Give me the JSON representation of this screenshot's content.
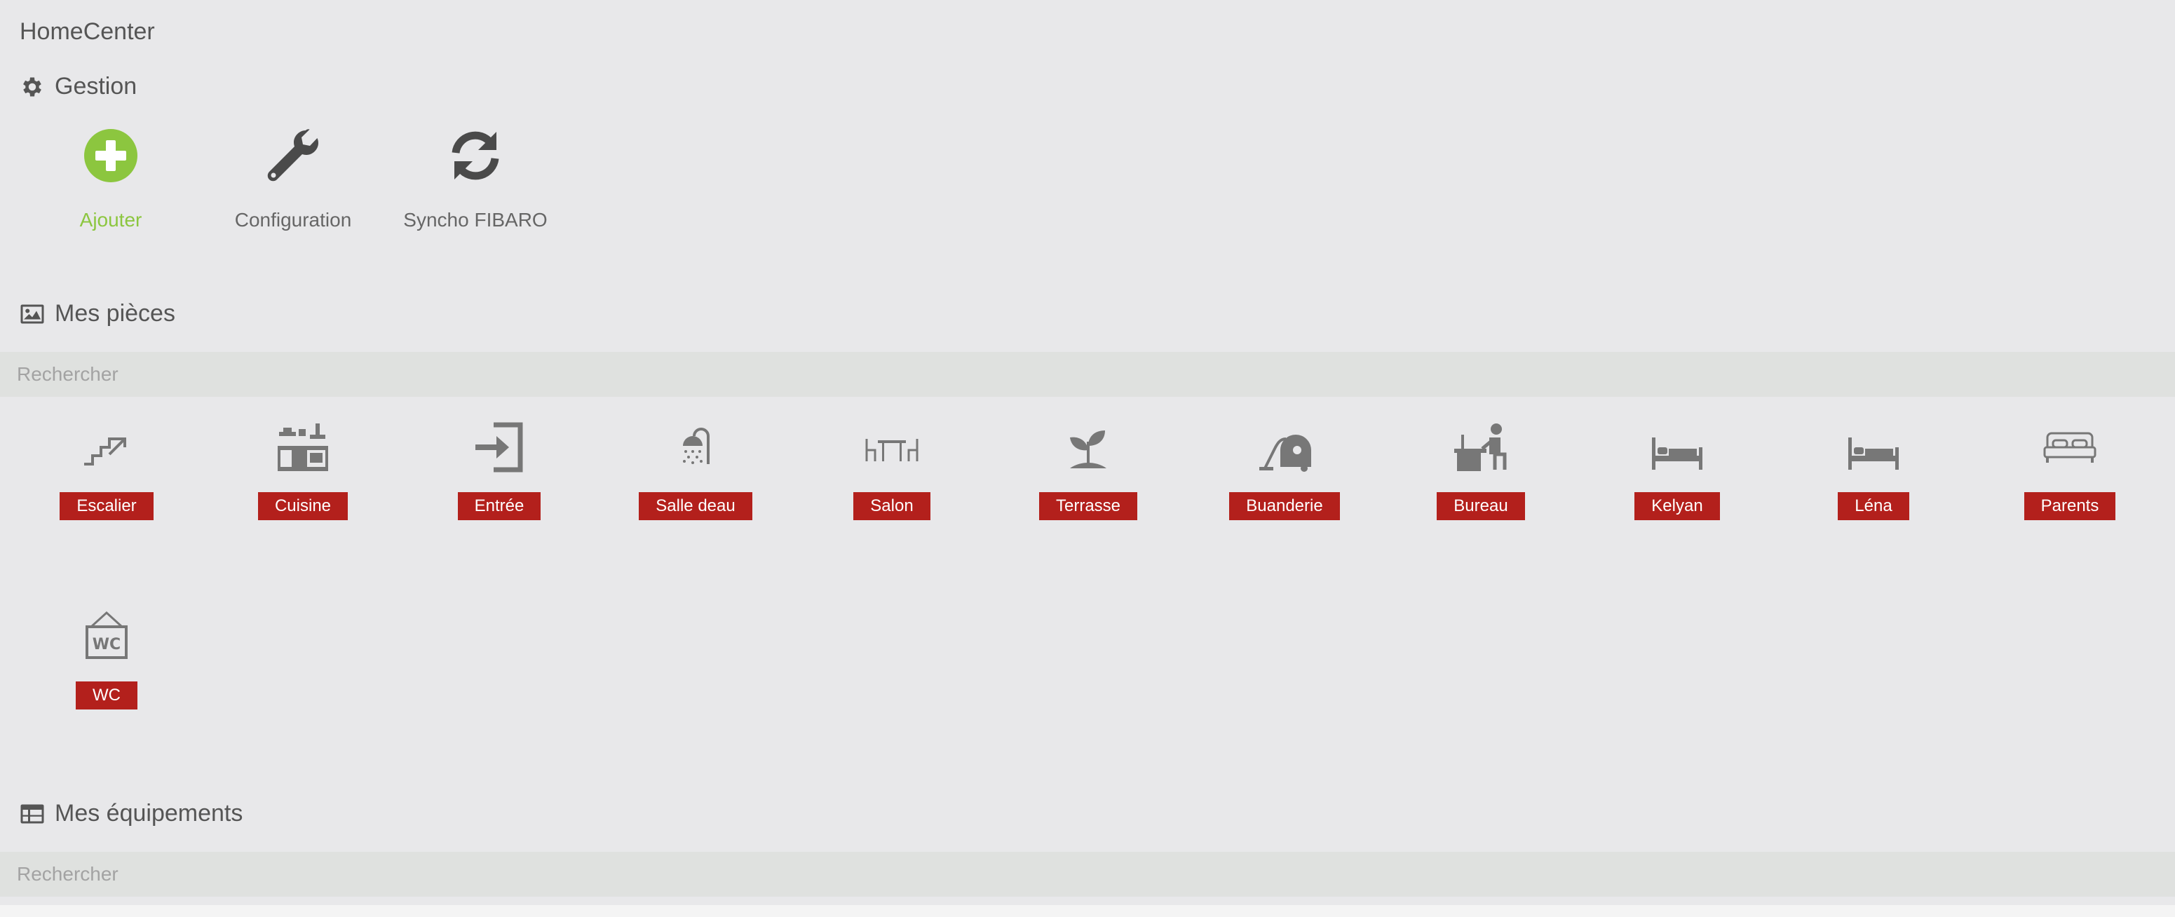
{
  "app": {
    "title": "HomeCenter"
  },
  "gestion": {
    "title": "Gestion",
    "icon": "gear-icon",
    "actions": [
      {
        "label": "Ajouter",
        "icon": "plus-circle-icon",
        "color": "#8cc63f"
      },
      {
        "label": "Configuration",
        "icon": "wrench-icon",
        "color": "#4a4a4a"
      },
      {
        "label": "Syncho FIBARO",
        "icon": "refresh-icon",
        "color": "#4a4a4a"
      }
    ]
  },
  "pieces": {
    "title": "Mes pièces",
    "icon": "image-icon",
    "search_placeholder": "Rechercher",
    "rooms": [
      {
        "label": "Escalier",
        "icon": "stairs-icon"
      },
      {
        "label": "Cuisine",
        "icon": "kitchen-icon"
      },
      {
        "label": "Entrée",
        "icon": "entrance-icon"
      },
      {
        "label": "Salle deau",
        "icon": "shower-icon"
      },
      {
        "label": "Salon",
        "icon": "dining-table-icon"
      },
      {
        "label": "Terrasse",
        "icon": "plant-icon"
      },
      {
        "label": "Buanderie",
        "icon": "vacuum-icon"
      },
      {
        "label": "Bureau",
        "icon": "desk-person-icon"
      },
      {
        "label": "Kelyan",
        "icon": "bed-icon"
      },
      {
        "label": "Léna",
        "icon": "bed-icon"
      },
      {
        "label": "Parents",
        "icon": "double-bed-icon"
      },
      {
        "label": "WC",
        "icon": "wc-sign-icon"
      }
    ],
    "label_color": "#b3201c"
  },
  "equipements": {
    "title": "Mes équipements",
    "icon": "table-icon",
    "search_placeholder": "Rechercher"
  }
}
